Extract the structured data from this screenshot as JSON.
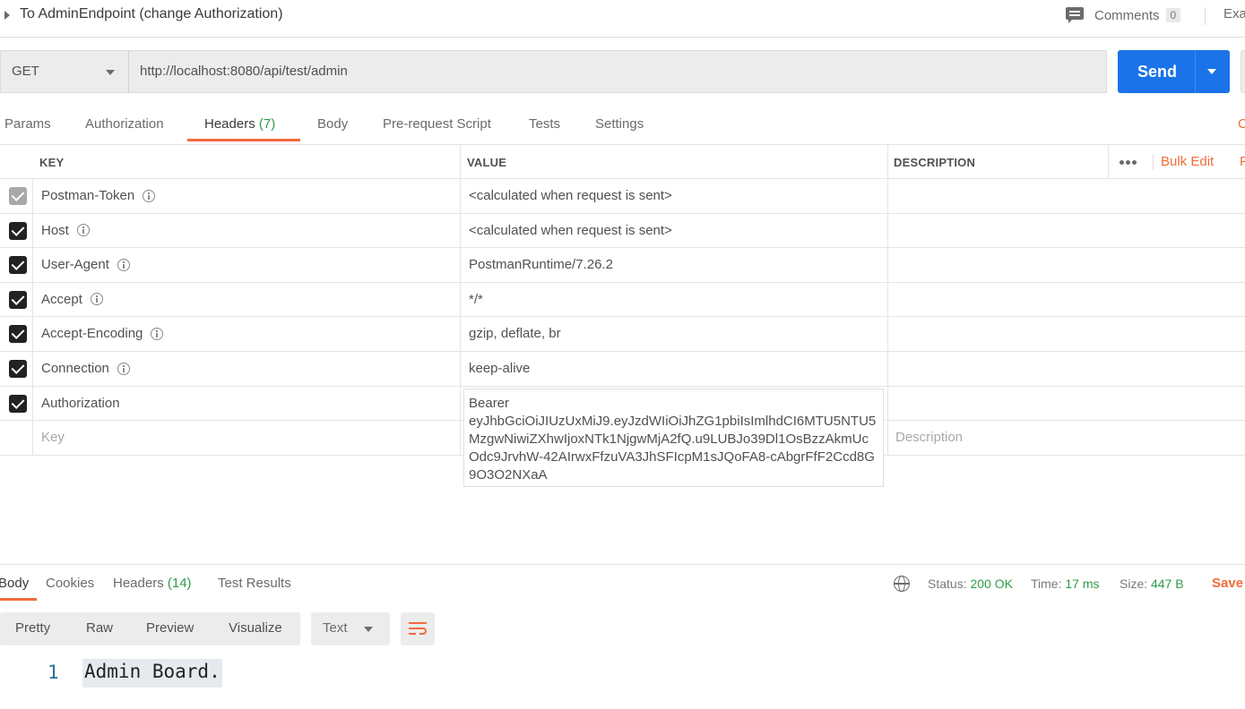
{
  "request": {
    "title": "To AdminEndpoint (change Authorization)",
    "comments_label": "Comments",
    "comments_count": "0",
    "examples_label": "Exa",
    "method": "GET",
    "url": "http://localhost:8080/api/test/admin",
    "send_label": "Send"
  },
  "tabs": [
    {
      "label": "Params"
    },
    {
      "label": "Authorization"
    },
    {
      "label": "Headers",
      "count": "(7)"
    },
    {
      "label": "Body"
    },
    {
      "label": "Pre-request Script"
    },
    {
      "label": "Tests"
    },
    {
      "label": "Settings"
    }
  ],
  "tabs_edge": "C",
  "headers_table": {
    "columns": {
      "key": "KEY",
      "value": "VALUE",
      "description": "DESCRIPTION"
    },
    "bulk_edit": "Bulk Edit",
    "presets_edge": "P",
    "rows": [
      {
        "key": "Postman-Token",
        "value": "<calculated when request is sent>",
        "checked": true
      },
      {
        "key": "Host",
        "value": "<calculated when request is sent>",
        "checked": true
      },
      {
        "key": "User-Agent",
        "value": "PostmanRuntime/7.26.2",
        "checked": true
      },
      {
        "key": "Accept",
        "value": "*/*",
        "checked": true
      },
      {
        "key": "Accept-Encoding",
        "value": "gzip, deflate, br",
        "checked": true
      },
      {
        "key": "Connection",
        "value": "keep-alive",
        "checked": true
      },
      {
        "key": "Authorization",
        "value": "Bearer eyJhbGciOiJIUzUxMiJ9.eyJzdWIiOiJhZG1pbiIsImlhdCI6MTU5NTU5MzgwNiwiZXhwIjoxNTk1NjgwMjA2fQ.u9LUBJo39Dl1OsBzzAkmUcOdc9JrvhW-42AIrwxFfzuVA3JhSFIcpM1sJQoFA8-cAbgrFfF2Ccd8G9O3O2NXaA",
        "checked": true
      }
    ],
    "token_display": "Bearer\neyJhbGciOiJIUzUxMiJ9.eyJzdWIiOiJhZG1pbiIsImlhdCI6MTU5NTU5MzgwNiwiZXhwIjoxNTk1NjgwMjA2fQ.u9LUBJo39Dl1OsBzzAkmUcOdc9JrvhW-42AIrwxFfzuVA3JhSFIcpM1sJQoFA8-cAbgrFfF2Ccd8G9O3O2NXaA",
    "new_row": {
      "key_placeholder": "Key",
      "description_placeholder": "Description"
    }
  },
  "response": {
    "tabs": [
      {
        "label": "Body"
      },
      {
        "label": "Cookies"
      },
      {
        "label": "Headers",
        "count": "(14)"
      },
      {
        "label": "Test Results"
      }
    ],
    "status_label": "Status:",
    "status_value": "200 OK",
    "time_label": "Time:",
    "time_value": "17 ms",
    "size_label": "Size:",
    "size_value": "447 B",
    "save_label": "Save",
    "view_tabs": [
      "Pretty",
      "Raw",
      "Preview",
      "Visualize"
    ],
    "format": "Text",
    "line_number": "1",
    "body_text": "Admin Board."
  },
  "colors": {
    "accent": "#f26b3a",
    "send_button": "#1a73e8",
    "count_green": "#2d9d46",
    "status_green": "#2d9d46"
  },
  "icons": [
    "caret-right-icon",
    "comment-icon",
    "chevron-down-icon",
    "more-icon",
    "info-icon",
    "checkbox-icon",
    "globe-icon",
    "wrap-lines-icon"
  ]
}
